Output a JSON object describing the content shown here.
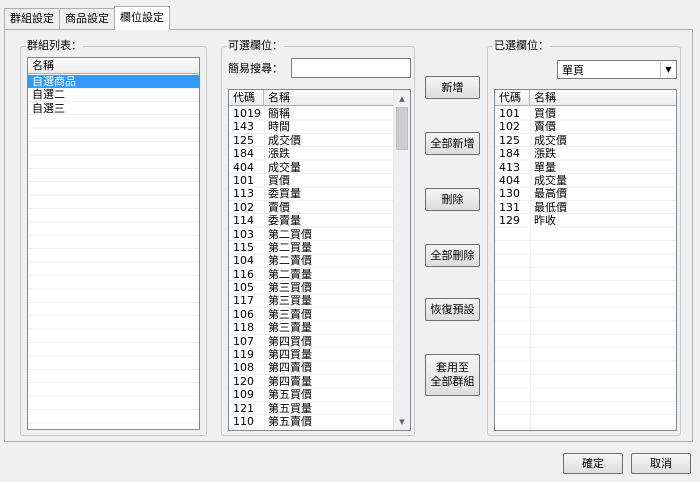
{
  "tabs": [
    "群組設定",
    "商品設定",
    "欄位設定"
  ],
  "groups_panel": {
    "title": "群組列表：",
    "header": "名稱",
    "items": [
      "自選商品",
      "自選二",
      "自選三"
    ],
    "selected_index": 0
  },
  "available_panel": {
    "title": "可選欄位：",
    "search_label": "簡易搜尋：",
    "search_value": "",
    "headers": [
      "代碼",
      "名稱"
    ],
    "rows": [
      [
        "1019",
        "簡稱"
      ],
      [
        "143",
        "時間"
      ],
      [
        "125",
        "成交價"
      ],
      [
        "184",
        "漲跌"
      ],
      [
        "404",
        "成交量"
      ],
      [
        "101",
        "買價"
      ],
      [
        "113",
        "委買量"
      ],
      [
        "102",
        "賣價"
      ],
      [
        "114",
        "委賣量"
      ],
      [
        "103",
        "第二買價"
      ],
      [
        "115",
        "第二買量"
      ],
      [
        "104",
        "第二賣價"
      ],
      [
        "116",
        "第二賣量"
      ],
      [
        "105",
        "第三買價"
      ],
      [
        "117",
        "第三買量"
      ],
      [
        "106",
        "第三賣價"
      ],
      [
        "118",
        "第三賣量"
      ],
      [
        "107",
        "第四買價"
      ],
      [
        "119",
        "第四買量"
      ],
      [
        "108",
        "第四賣價"
      ],
      [
        "120",
        "第四賣量"
      ],
      [
        "109",
        "第五買價"
      ],
      [
        "121",
        "第五買量"
      ],
      [
        "110",
        "第五賣價"
      ]
    ]
  },
  "buttons": {
    "add": "新增",
    "add_all": "全部新增",
    "remove": "刪除",
    "remove_all": "全部刪除",
    "restore_default": "恢復預設",
    "apply_all_line1": "套用至",
    "apply_all_line2": "全部群組"
  },
  "selected_panel": {
    "title": "已選欄位：",
    "combo_value": "單頁",
    "headers": [
      "代碼",
      "名稱"
    ],
    "rows": [
      [
        "101",
        "買價"
      ],
      [
        "102",
        "賣價"
      ],
      [
        "125",
        "成交價"
      ],
      [
        "184",
        "漲跌"
      ],
      [
        "413",
        "單量"
      ],
      [
        "404",
        "成交量"
      ],
      [
        "130",
        "最高價"
      ],
      [
        "131",
        "最低價"
      ],
      [
        "129",
        "昨收"
      ]
    ]
  },
  "footer": {
    "ok": "確定",
    "cancel": "取消"
  }
}
